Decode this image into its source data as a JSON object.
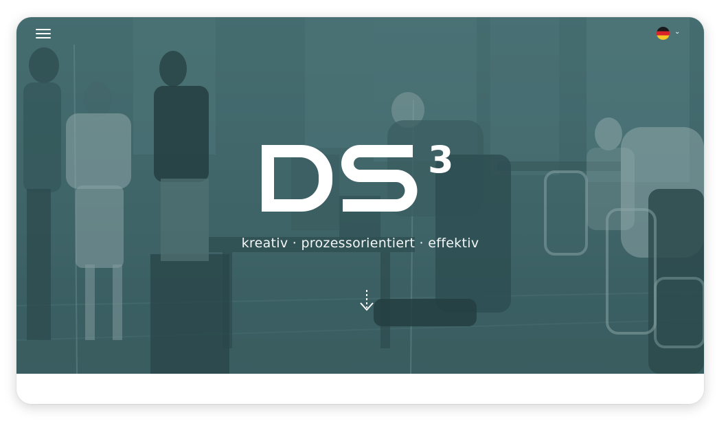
{
  "hero": {
    "tagline": "kreativ · prozessorientiert · effektiv"
  },
  "logo": {
    "letters": "DS",
    "superscript": "3"
  },
  "icons": {
    "menu": "hamburger-menu-icon",
    "language_flag": "german-flag-icon",
    "language_chevron": "chevron-down-icon",
    "scroll": "arrow-down-icon"
  },
  "colors": {
    "overlay": "#45696d",
    "text": "#ffffff",
    "background": "#ffffff"
  }
}
